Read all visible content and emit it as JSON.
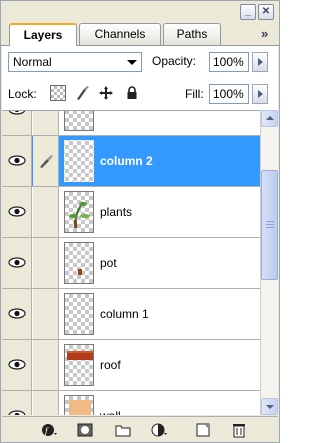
{
  "tabs": [
    {
      "label": "Layers",
      "active": true
    },
    {
      "label": "Channels",
      "active": false
    },
    {
      "label": "Paths",
      "active": false
    }
  ],
  "panel_menu_icon": "double-chevron-right-icon",
  "blend_mode": "Normal",
  "opacity_label": "Opacity:",
  "opacity_value": "100%",
  "lock_label": "Lock:",
  "fill_label": "Fill:",
  "fill_value": "100%",
  "layers": [
    {
      "name": "",
      "visible": true,
      "selected": false
    },
    {
      "name": "column 2",
      "visible": true,
      "selected": true
    },
    {
      "name": "plants",
      "visible": true,
      "selected": false
    },
    {
      "name": "pot",
      "visible": true,
      "selected": false
    },
    {
      "name": "column 1",
      "visible": true,
      "selected": false
    },
    {
      "name": "roof",
      "visible": true,
      "selected": false
    },
    {
      "name": "wall",
      "visible": true,
      "selected": false
    }
  ],
  "toolbar_icons": [
    "link-layers-icon",
    "layer-style-icon",
    "layer-mask-icon",
    "new-group-icon",
    "adjustment-layer-icon",
    "new-layer-icon",
    "trash-icon"
  ],
  "colors": {
    "selection": "#3399ff",
    "panel": "#ece9d8",
    "active_tab_accent": "#f5a623"
  }
}
